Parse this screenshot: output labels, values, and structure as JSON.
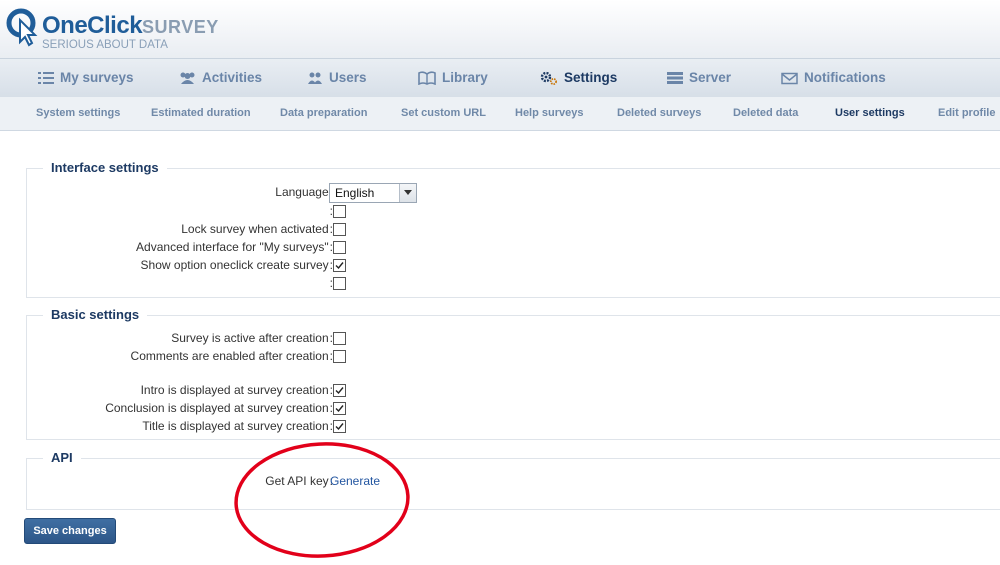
{
  "header": {
    "brand_main": "OneClick",
    "brand_suffix": "SURVEY",
    "tagline": "SERIOUS ABOUT DATA"
  },
  "main_nav": [
    {
      "label": "My surveys",
      "icon": "list-icon",
      "active": false
    },
    {
      "label": "Activities",
      "icon": "users-group-icon",
      "active": false
    },
    {
      "label": "Users",
      "icon": "user-icon",
      "active": false
    },
    {
      "label": "Library",
      "icon": "book-icon",
      "active": false
    },
    {
      "label": "Settings",
      "icon": "gears-icon",
      "active": true
    },
    {
      "label": "Server",
      "icon": "server-icon",
      "active": false
    },
    {
      "label": "Notifications",
      "icon": "envelope-icon",
      "active": false
    }
  ],
  "sub_nav": [
    {
      "label": "System settings",
      "active": false
    },
    {
      "label": "Estimated duration",
      "active": false
    },
    {
      "label": "Data preparation",
      "active": false
    },
    {
      "label": "Set custom URL",
      "active": false
    },
    {
      "label": "Help surveys",
      "active": false
    },
    {
      "label": "Deleted surveys",
      "active": false
    },
    {
      "label": "Deleted data",
      "active": false
    },
    {
      "label": "User settings",
      "active": true
    },
    {
      "label": "Edit profile",
      "active": false
    }
  ],
  "interface_settings": {
    "legend": "Interface settings",
    "language_label": "Language",
    "language_value": "English",
    "rows": [
      {
        "label": "",
        "checked": false
      },
      {
        "label": "Lock survey when activated",
        "checked": false
      },
      {
        "label": "Advanced interface for \"My surveys\"",
        "checked": false
      },
      {
        "label": "Show option oneclick create survey",
        "checked": true
      },
      {
        "label": "",
        "checked": false
      }
    ]
  },
  "basic_settings": {
    "legend": "Basic settings",
    "rows": [
      {
        "label": "Survey is active after creation",
        "checked": false
      },
      {
        "label": "Comments are enabled after creation",
        "checked": false
      },
      {
        "label": "Intro is displayed at survey creation",
        "checked": true
      },
      {
        "label": "Conclusion is displayed at survey creation",
        "checked": true
      },
      {
        "label": "Title is displayed at survey creation",
        "checked": true
      }
    ]
  },
  "api": {
    "legend": "API",
    "key_label": "Get API key",
    "generate_link": "Generate"
  },
  "save_button": "Save changes",
  "colors": {
    "brand": "#1f5d99",
    "nav_text": "#6a85a8",
    "active_text": "#1d3a63",
    "button": "#2d5688",
    "annotation": "#e2001a"
  }
}
